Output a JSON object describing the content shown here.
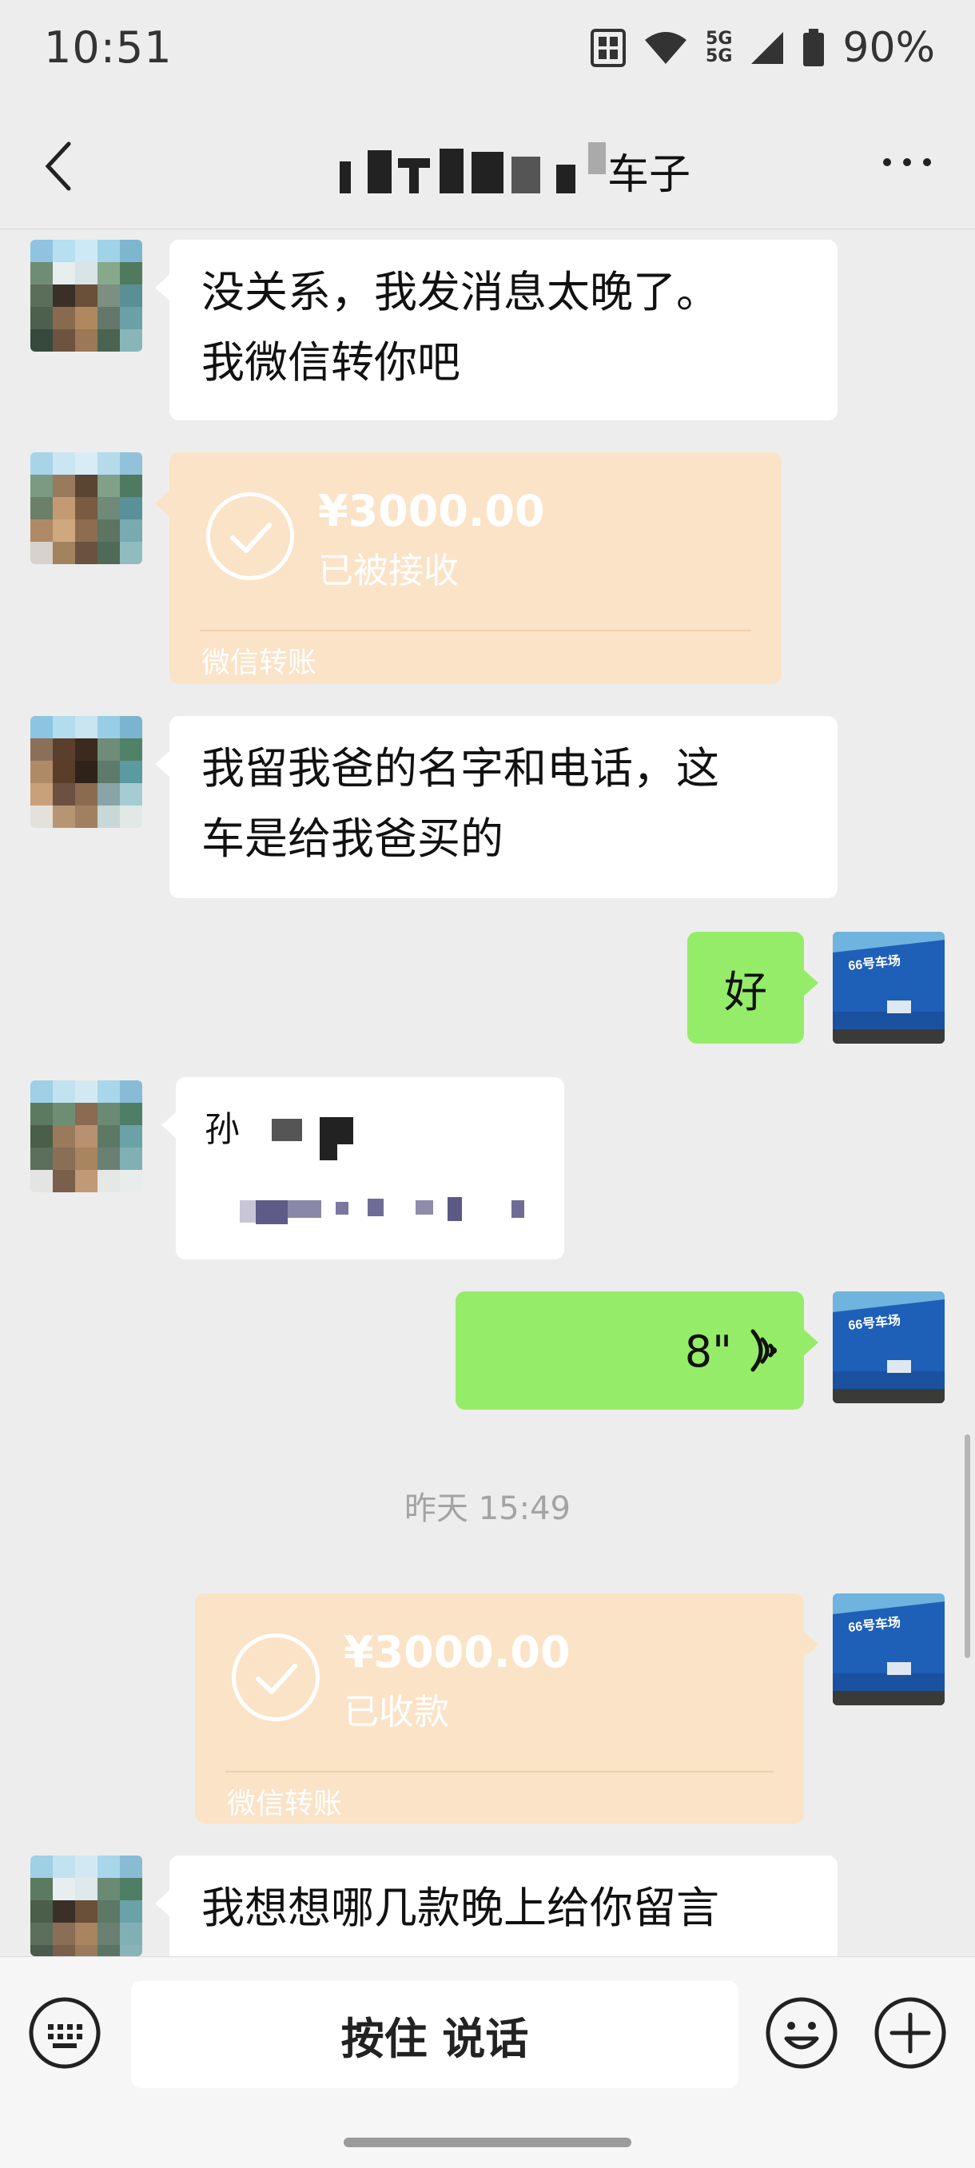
{
  "status_bar": {
    "time": "10:51",
    "network_top": "5G",
    "network_bottom": "5G",
    "battery": "90%"
  },
  "nav": {
    "title": "车子"
  },
  "messages": {
    "m1_line1": "没关系，我发消息太晚了。",
    "m1_line2": "我微信转你吧",
    "t1_amount": "¥3000.00",
    "t1_status": "已被接收",
    "t1_brand": "微信转账",
    "m2_line1": "我留我爸的名字和电话，这",
    "m2_line2": "车是给我爸买的",
    "m3_text": "好",
    "m4_visible": "孙",
    "m5_duration": "8\"",
    "timestamp": "昨天 15:49",
    "t2_amount": "¥3000.00",
    "t2_status": "已收款",
    "t2_brand": "微信转账",
    "m6_text": "我想想哪几款晚上给你留言"
  },
  "avatar_right": {
    "sign_text": "66号车场"
  },
  "input_bar": {
    "hold_to_talk": "按住 说话"
  },
  "colors": {
    "background": "#ededed",
    "my_bubble": "#95ec69",
    "transfer_card": "#fbe3c7",
    "incoming_bubble": "#ffffff"
  },
  "icons": [
    "chevron-left-icon",
    "more-icon",
    "voice-wave-icon",
    "check-icon",
    "keyboard-icon",
    "emoji-icon",
    "plus-icon",
    "wifi-icon",
    "battery-icon",
    "nfc-icon"
  ]
}
